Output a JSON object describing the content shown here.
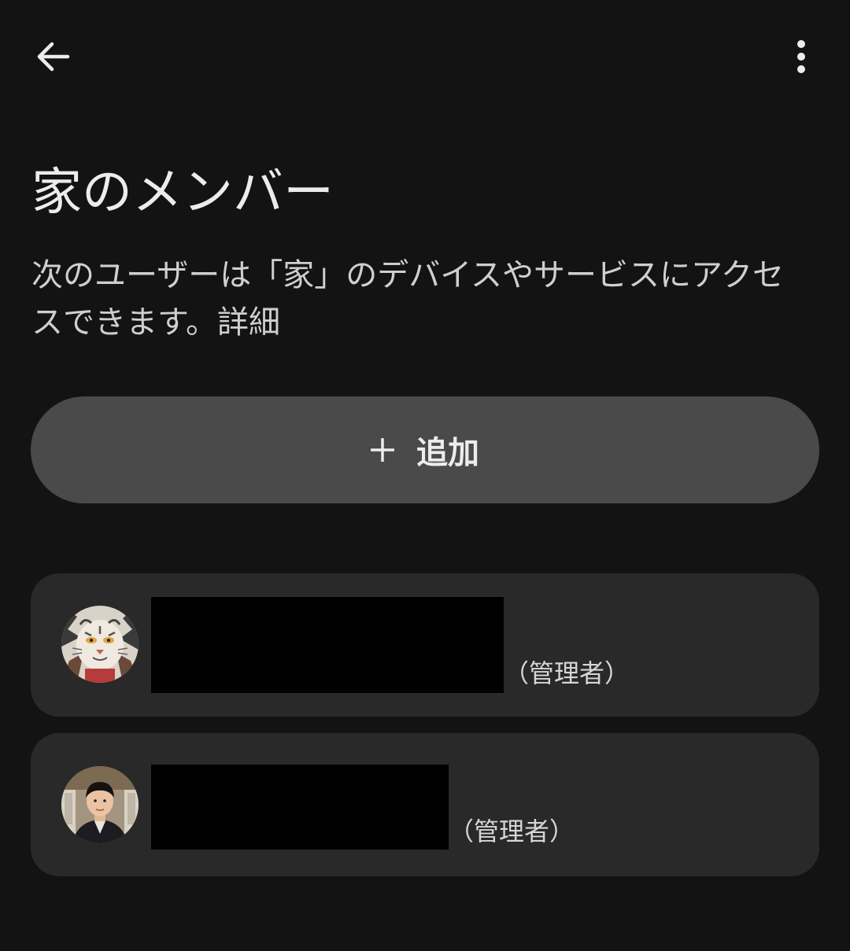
{
  "header": {
    "back_icon": "arrow-back-icon",
    "more_icon": "more-vert-icon"
  },
  "page": {
    "title": "家のメンバー",
    "description": "次のユーザーは「家」のデバイスやサービスにアクセスできます。",
    "details_link": "詳細"
  },
  "add_button": {
    "icon": "plus-icon",
    "label": "追加"
  },
  "members": [
    {
      "avatar": "tiger-illustration-avatar",
      "role": "（管理者）"
    },
    {
      "avatar": "person-photo-avatar",
      "role": "（管理者）"
    }
  ],
  "colors": {
    "background": "#131313",
    "button": "#4a4a4a",
    "card": "#292929",
    "text": "#ececec"
  }
}
